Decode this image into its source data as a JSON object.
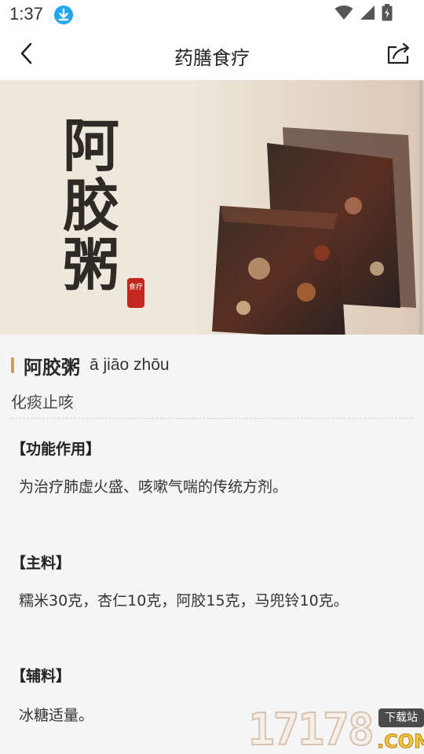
{
  "status_bar": {
    "time": "1:37",
    "icons": [
      "download-icon",
      "wifi-icon",
      "signal-icon",
      "battery-icon"
    ]
  },
  "app_bar": {
    "title": "药膳食疗",
    "icons": [
      "back-arrow-icon",
      "share-icon"
    ]
  },
  "hero": {
    "title_text": "阿胶粥",
    "seal_text": "食疗"
  },
  "recipe": {
    "name": "阿胶粥",
    "pinyin": "ā jiāo zhōu",
    "tagline": "化痰止咳",
    "sections": [
      {
        "heading": "【功能作用】",
        "body": "为治疗肺虚火盛、咳嗽气喘的传统方剂。"
      },
      {
        "heading": "【主料】",
        "body": "糯米30克，杏仁10克，阿胶15克，马兜铃10克。"
      },
      {
        "heading": "【辅料】",
        "body": "冰糖适量。"
      }
    ]
  },
  "watermark": {
    "number": "17178",
    "domain": ".COM",
    "tag": "下载站"
  },
  "colors": {
    "accent": "#c9a15f",
    "seal_red": "#c4271c",
    "download_blue": "#23a6f2"
  }
}
